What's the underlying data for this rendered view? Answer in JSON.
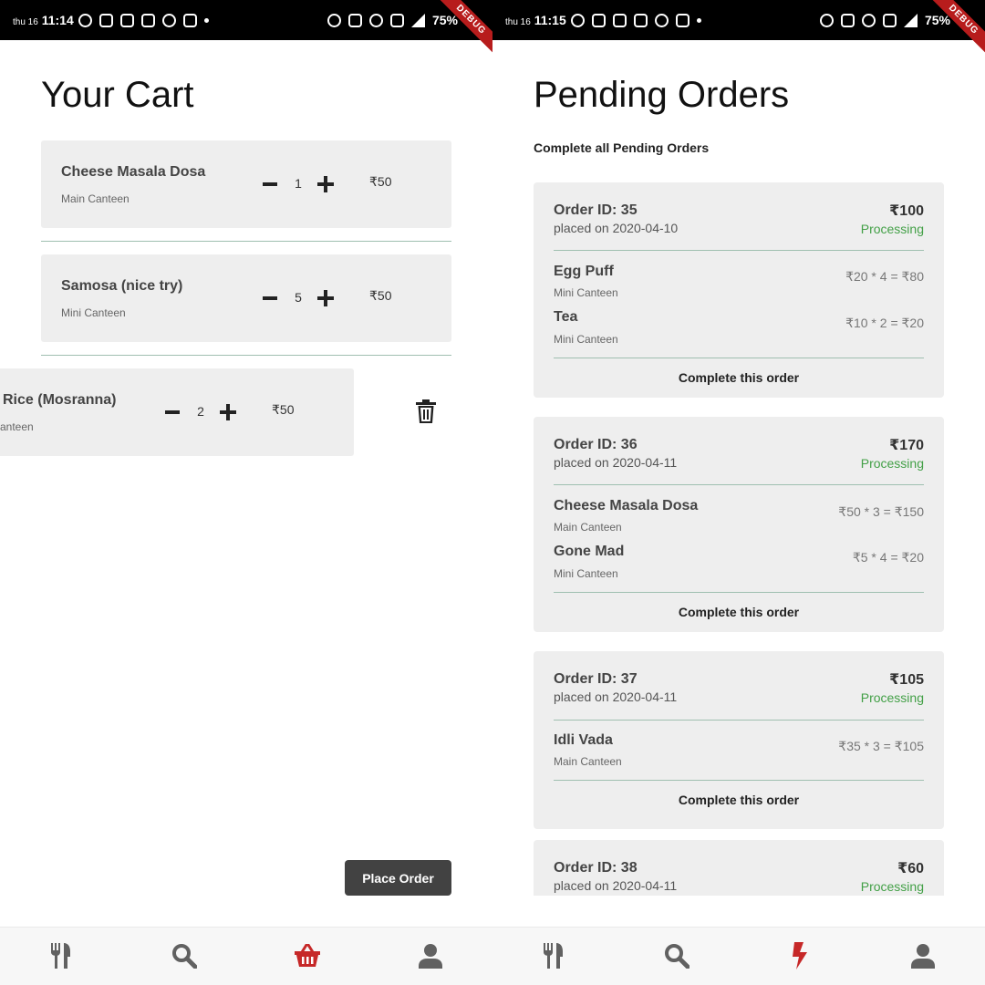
{
  "colors": {
    "accent": "#c62828",
    "processing": "#43a047",
    "card_bg": "#eeeeee",
    "button_dark": "#424242",
    "icon_grey": "#616161"
  },
  "left": {
    "status": {
      "day": "thu 16",
      "time": "11:14",
      "battery": "75%",
      "debug": "DEBUG"
    },
    "title": "Your Cart",
    "cart": [
      {
        "name": "Cheese Masala Dosa",
        "canteen": "Main Canteen",
        "qty": "1",
        "price": "₹50"
      },
      {
        "name": "Samosa (nice try)",
        "canteen": "Mini Canteen",
        "qty": "5",
        "price": "₹50"
      },
      {
        "name": "Rice (Mosranna)",
        "canteen": "anteen",
        "qty": "2",
        "price": "₹50"
      }
    ],
    "place_order": "Place Order",
    "nav": [
      "fork-knife-icon",
      "search-icon",
      "basket-icon",
      "user-icon"
    ],
    "nav_active": "basket-icon"
  },
  "right": {
    "status": {
      "day": "thu 16",
      "time": "11:15",
      "battery": "75%",
      "debug": "DEBUG"
    },
    "title": "Pending Orders",
    "subtitle": "Complete all Pending Orders",
    "orders": [
      {
        "id": "Order ID: 35",
        "date": "placed on 2020-04-10",
        "total": "₹100",
        "status": "Processing",
        "items": [
          {
            "name": "Egg Puff",
            "canteen": "Mini Canteen",
            "calc": "₹20 * 4 = ₹80"
          },
          {
            "name": "Tea",
            "canteen": "Mini Canteen",
            "calc": "₹10 * 2 = ₹20"
          }
        ],
        "action": "Complete this order"
      },
      {
        "id": "Order ID: 36",
        "date": "placed on 2020-04-11",
        "total": "₹170",
        "status": "Processing",
        "items": [
          {
            "name": "Cheese Masala Dosa",
            "canteen": "Main Canteen",
            "calc": "₹50 * 3 = ₹150"
          },
          {
            "name": "Gone Mad",
            "canteen": "Mini Canteen",
            "calc": "₹5 * 4 = ₹20"
          }
        ],
        "action": "Complete this order"
      },
      {
        "id": "Order ID: 37",
        "date": "placed on 2020-04-11",
        "total": "₹105",
        "status": "Processing",
        "items": [
          {
            "name": "Idli Vada",
            "canteen": "Main Canteen",
            "calc": "₹35 * 3 = ₹105"
          }
        ],
        "action": "Complete this order"
      },
      {
        "id": "Order ID: 38",
        "date": "placed on 2020-04-11",
        "total": "₹60",
        "status": "Processing",
        "items": [],
        "action": ""
      }
    ],
    "nav": [
      "fork-knife-icon",
      "search-icon",
      "bolt-icon",
      "user-icon"
    ],
    "nav_active": "bolt-icon"
  }
}
